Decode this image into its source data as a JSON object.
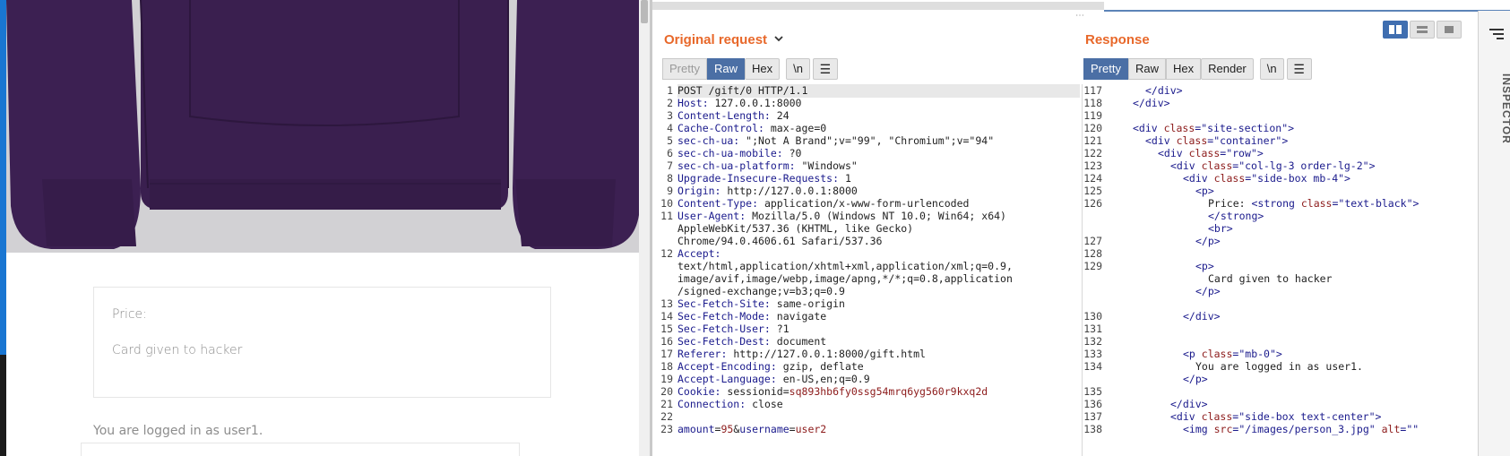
{
  "browser": {
    "price_label": "Price:",
    "card_message": "Card given to hacker",
    "logged_in_text": "You are logged in as user1."
  },
  "burp": {
    "request_title": "Original request",
    "response_title": "Response",
    "request_tabs": [
      "Pretty",
      "Raw",
      "Hex",
      "\\n"
    ],
    "request_active_tab": "Raw",
    "response_tabs": [
      "Pretty",
      "Raw",
      "Hex",
      "Render",
      "\\n"
    ],
    "response_active_tab": "Pretty",
    "inspector_label": "INSPECTOR",
    "colors": {
      "title_orange": "#e8682a",
      "active_tab_blue": "#4b6fa5"
    },
    "request_lines": [
      {
        "n": "1",
        "k": "",
        "v": "POST /gift/0 HTTP/1.1"
      },
      {
        "n": "2",
        "k": "Host:",
        "v": " 127.0.0.1:8000"
      },
      {
        "n": "3",
        "k": "Content-Length:",
        "v": " 24"
      },
      {
        "n": "4",
        "k": "Cache-Control:",
        "v": " max-age=0"
      },
      {
        "n": "5",
        "k": "sec-ch-ua:",
        "v": " \";Not A Brand\";v=\"99\", \"Chromium\";v=\"94\""
      },
      {
        "n": "6",
        "k": "sec-ch-ua-mobile:",
        "v": " ?0"
      },
      {
        "n": "7",
        "k": "sec-ch-ua-platform:",
        "v": " \"Windows\""
      },
      {
        "n": "8",
        "k": "Upgrade-Insecure-Requests:",
        "v": " 1"
      },
      {
        "n": "9",
        "k": "Origin:",
        "v": " http://127.0.0.1:8000"
      },
      {
        "n": "10",
        "k": "Content-Type:",
        "v": " application/x-www-form-urlencoded"
      },
      {
        "n": "11",
        "k": "User-Agent:",
        "v": " Mozilla/5.0 (Windows NT 10.0; Win64; x64)"
      },
      {
        "n": "",
        "k": "",
        "v": "AppleWebKit/537.36 (KHTML, like Gecko)"
      },
      {
        "n": "",
        "k": "",
        "v": "Chrome/94.0.4606.61 Safari/537.36"
      },
      {
        "n": "12",
        "k": "Accept:",
        "v": ""
      },
      {
        "n": "",
        "k": "",
        "v": "text/html,application/xhtml+xml,application/xml;q=0.9,"
      },
      {
        "n": "",
        "k": "",
        "v": "image/avif,image/webp,image/apng,*/*;q=0.8,application"
      },
      {
        "n": "",
        "k": "",
        "v": "/signed-exchange;v=b3;q=0.9"
      },
      {
        "n": "13",
        "k": "Sec-Fetch-Site:",
        "v": " same-origin"
      },
      {
        "n": "14",
        "k": "Sec-Fetch-Mode:",
        "v": " navigate"
      },
      {
        "n": "15",
        "k": "Sec-Fetch-User:",
        "v": " ?1"
      },
      {
        "n": "16",
        "k": "Sec-Fetch-Dest:",
        "v": " document"
      },
      {
        "n": "17",
        "k": "Referer:",
        "v": " http://127.0.0.1:8000/gift.html"
      },
      {
        "n": "18",
        "k": "Accept-Encoding:",
        "v": " gzip, deflate"
      },
      {
        "n": "19",
        "k": "Accept-Language:",
        "v": " en-US,en;q=0.9"
      },
      {
        "n": "20",
        "k": "Cookie:",
        "v": " sessionid=",
        "c": "sq893hb6fy0ssg54mrq6yg560r9kxq2d"
      },
      {
        "n": "21",
        "k": "Connection:",
        "v": " close"
      },
      {
        "n": "22",
        "k": "",
        "v": ""
      },
      {
        "n": "23",
        "k": "",
        "v": "",
        "body": "amount=95&username=user2"
      }
    ],
    "response_lines": [
      {
        "n": "117",
        "indent": 2,
        "html": "</div>"
      },
      {
        "n": "118",
        "indent": 1,
        "html": "</div>"
      },
      {
        "n": "119",
        "indent": 0,
        "html": ""
      },
      {
        "n": "120",
        "indent": 1,
        "open": "div",
        "attr": "class",
        "val": "site-section"
      },
      {
        "n": "121",
        "indent": 2,
        "open": "div",
        "attr": "class",
        "val": "container"
      },
      {
        "n": "122",
        "indent": 3,
        "open": "div",
        "attr": "class",
        "val": "row"
      },
      {
        "n": "123",
        "indent": 4,
        "open": "div",
        "attr": "class",
        "val": "col-lg-3 order-lg-2"
      },
      {
        "n": "124",
        "indent": 5,
        "open": "div",
        "attr": "class",
        "val": "side-box mb-4"
      },
      {
        "n": "125",
        "indent": 6,
        "html": "<p>"
      },
      {
        "n": "126",
        "indent": 7,
        "text": "Price: ",
        "open": "strong",
        "attr": "class",
        "val": "text-black"
      },
      {
        "n": "",
        "indent": 7,
        "html": "</strong>"
      },
      {
        "n": "",
        "indent": 7,
        "html": "<br>"
      },
      {
        "n": "127",
        "indent": 6,
        "html": "</p>"
      },
      {
        "n": "128",
        "indent": 0,
        "html": ""
      },
      {
        "n": "129",
        "indent": 6,
        "html": "<p>"
      },
      {
        "n": "",
        "indent": 7,
        "text": "Card given to hacker"
      },
      {
        "n": "",
        "indent": 6,
        "html": "</p>"
      },
      {
        "n": "",
        "indent": 0,
        "html": ""
      },
      {
        "n": "130",
        "indent": 5,
        "html": "</div>"
      },
      {
        "n": "131",
        "indent": 0,
        "html": ""
      },
      {
        "n": "132",
        "indent": 0,
        "html": ""
      },
      {
        "n": "133",
        "indent": 5,
        "open": "p",
        "attr": "class",
        "val": "mb-0"
      },
      {
        "n": "134",
        "indent": 6,
        "text": "You are logged in as user1."
      },
      {
        "n": "",
        "indent": 5,
        "html": "</p>"
      },
      {
        "n": "135",
        "indent": 0,
        "html": ""
      },
      {
        "n": "136",
        "indent": 4,
        "html": "</div>"
      },
      {
        "n": "137",
        "indent": 4,
        "open": "div",
        "attr": "class",
        "val": "side-box text-center"
      },
      {
        "n": "138",
        "indent": 5,
        "open": "img",
        "attr": "src",
        "val": "/images/person_3.jpg",
        "attr2": "alt",
        "val2": ""
      }
    ]
  }
}
